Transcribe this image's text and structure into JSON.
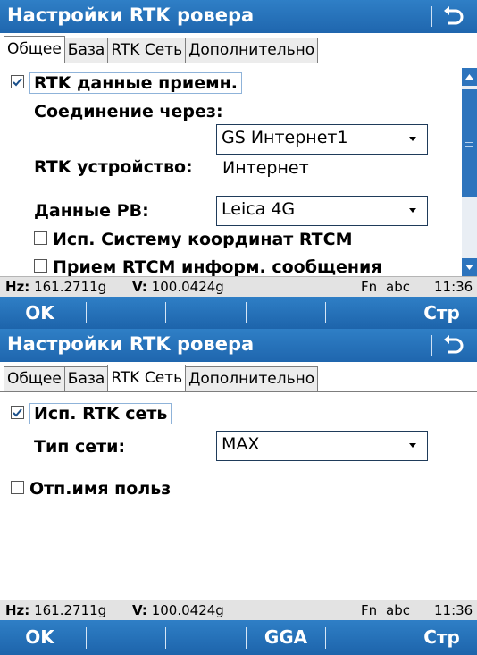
{
  "screens": [
    {
      "title": "Настройки RTK ровера",
      "tabs": [
        "Общее",
        "База",
        "RTK Сеть",
        "Дополнительно"
      ],
      "active_tab": "Общее",
      "rtk_data_checkbox": {
        "label": "RTK данные приемн.",
        "checked": true
      },
      "connection_label": "Соединение через:",
      "connection_value": "GS Интернет1",
      "rtk_device_label": "RTK устройство:",
      "rtk_device_value": "Интернет",
      "rb_data_label": "Данные РВ:",
      "rb_data_value": "Leica 4G",
      "rtcm_coord_checkbox": {
        "label": "Исп. Систему координат RTCM",
        "checked": false
      },
      "rtcm_info_checkbox": {
        "label": "Прием RTCM информ. сообщения",
        "checked": false
      },
      "status": {
        "hz_label": "Hz:",
        "hz_value": "161.2711g",
        "v_label": "V:",
        "v_value": "100.0424g",
        "fn": "Fn",
        "abc": "abc",
        "time": "11:36"
      },
      "softkeys": {
        "f1": "OK",
        "f2": "",
        "f3": "",
        "f4": "",
        "f5": "",
        "f6": "Стр"
      }
    },
    {
      "title": "Настройки RTK ровера",
      "tabs": [
        "Общее",
        "База",
        "RTK Сеть",
        "Дополнительно"
      ],
      "active_tab": "RTK Сеть",
      "use_rtk_net_checkbox": {
        "label": "Исп.  RTK сеть",
        "checked": true
      },
      "net_type_label": "Тип сети:",
      "net_type_value": "MAX",
      "send_user_checkbox": {
        "label": "Отп.имя польз",
        "checked": false
      },
      "status": {
        "hz_label": "Hz:",
        "hz_value": "161.2711g",
        "v_label": "V:",
        "v_value": "100.0424g",
        "fn": "Fn",
        "abc": "abc",
        "time": "11:36"
      },
      "softkeys": {
        "f1": "OK",
        "f2": "",
        "f3": "",
        "f4": "GGA",
        "f5": "",
        "f6": "Стр"
      }
    }
  ],
  "colors": {
    "title_bar": "#2176bd",
    "softkey_bar": "#2176bd",
    "status_bar": "#e3e3e3"
  },
  "icons": {
    "back": "return-arrow-icon",
    "checkbox_checked": "checkmark-icon",
    "dropdown": "dropdown-arrow-icon"
  }
}
